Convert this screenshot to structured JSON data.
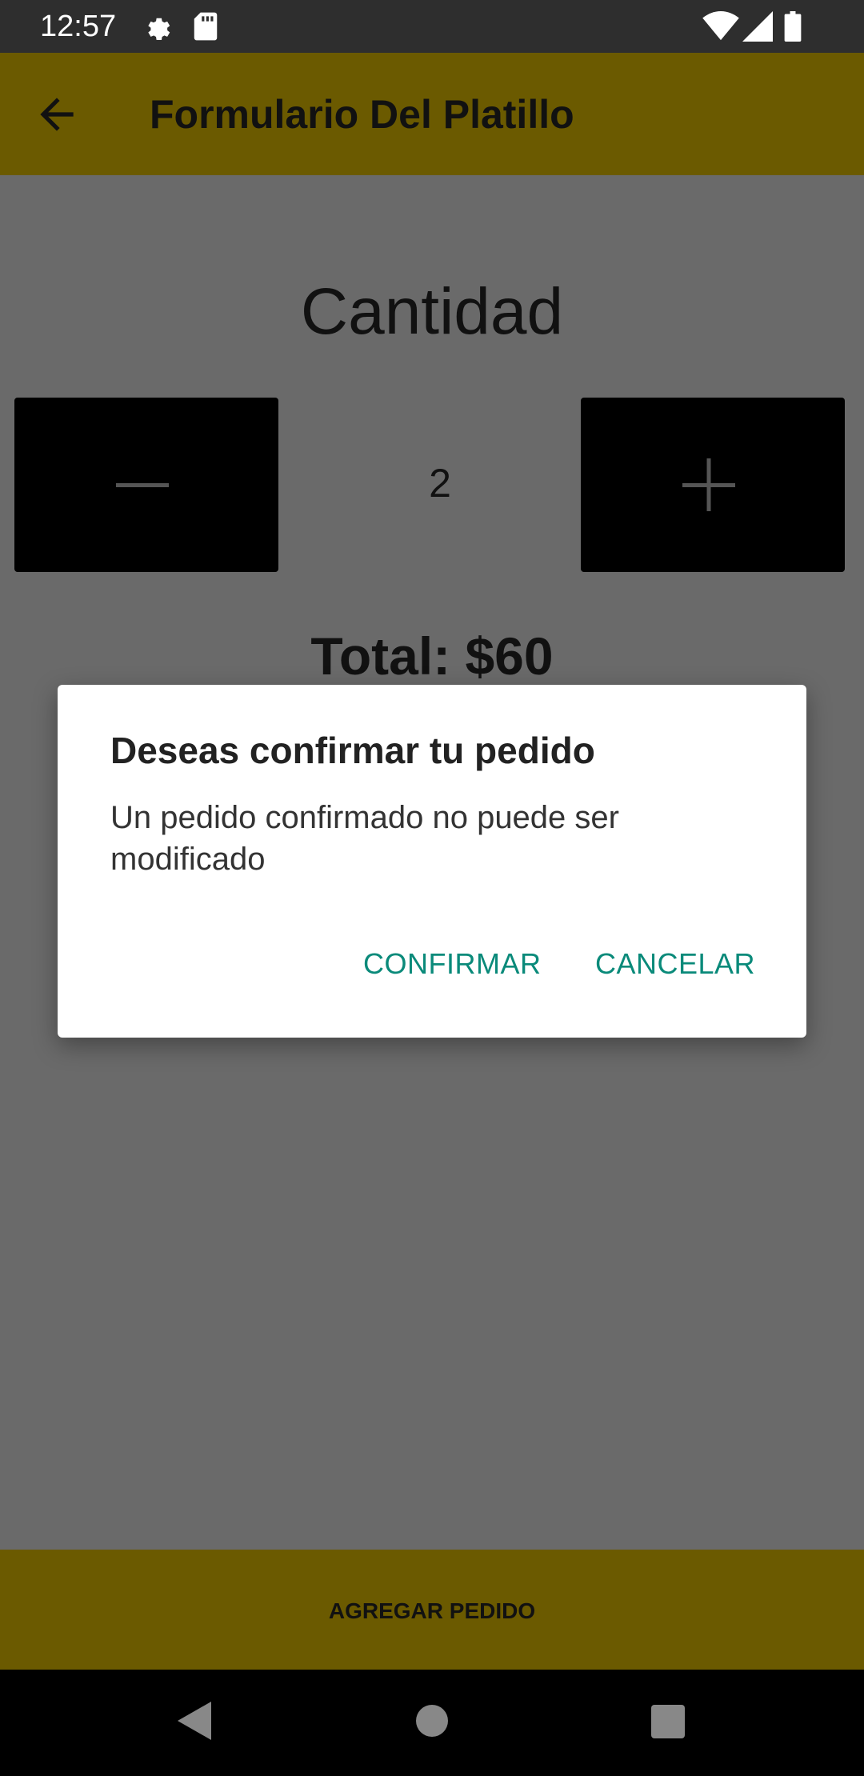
{
  "status_bar": {
    "time": "12:57",
    "icons": [
      "gear-icon",
      "sd-card-icon",
      "wifi-icon",
      "signal-icon",
      "battery-icon"
    ]
  },
  "app_bar": {
    "back_icon": "arrow-left-icon",
    "title": "Formulario Del Platillo",
    "color": "#6b5a00"
  },
  "quantity": {
    "label": "Cantidad",
    "value": "2",
    "decrement_icon": "minus-icon",
    "increment_icon": "plus-icon"
  },
  "total": {
    "text": "Total: $60"
  },
  "bottom_button": {
    "label": "AGREGAR PEDIDO"
  },
  "dialog": {
    "title": "Deseas confirmar tu pedido",
    "message": "Un pedido confirmado no puede ser modificado",
    "confirm_label": "CONFIRMAR",
    "cancel_label": "CANCELAR",
    "accent_color": "#0a8a7a"
  },
  "nav_bar": {
    "icons": [
      "back-triangle-icon",
      "home-circle-icon",
      "recents-square-icon"
    ]
  }
}
